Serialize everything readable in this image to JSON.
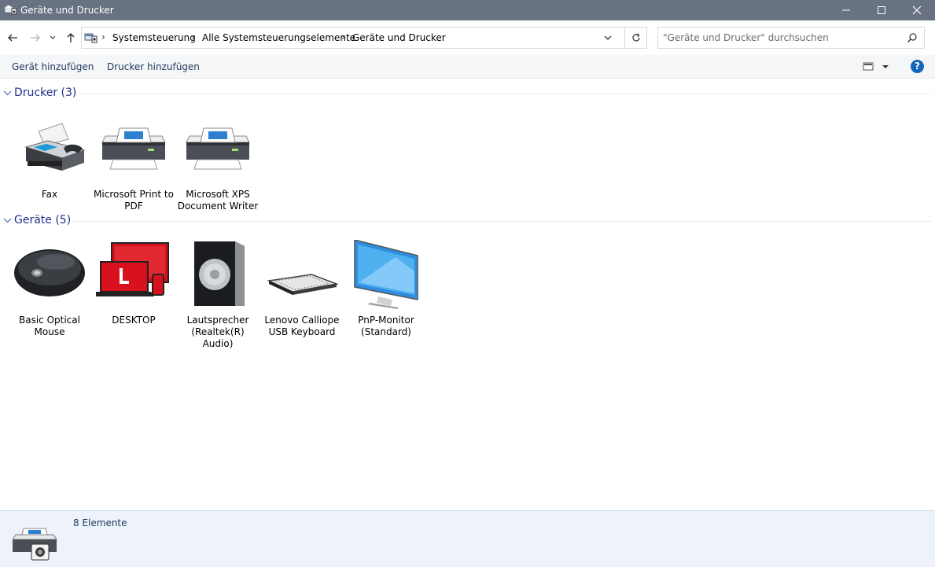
{
  "window": {
    "title": "Geräte und Drucker"
  },
  "address": {
    "breadcrumb": [
      "Systemsteuerung",
      "Alle Systemsteuerungselemente",
      "Geräte und Drucker"
    ]
  },
  "search": {
    "placeholder": "\"Geräte und Drucker\" durchsuchen"
  },
  "toolbar": {
    "add_device": "Gerät hinzufügen",
    "add_printer": "Drucker hinzufügen",
    "help": "?"
  },
  "groups": {
    "printers": {
      "label": "Drucker (3)",
      "items": [
        {
          "label": "Fax",
          "icon": "fax-icon"
        },
        {
          "label": "Microsoft Print to PDF",
          "icon": "printer-icon"
        },
        {
          "label": "Microsoft XPS Document Writer",
          "icon": "printer-icon"
        }
      ]
    },
    "devices": {
      "label": "Geräte (5)",
      "items": [
        {
          "label": "Basic Optical Mouse",
          "icon": "mouse-icon"
        },
        {
          "label": "DESKTOP",
          "icon": "computer-icon"
        },
        {
          "label": "Lautsprecher (Realtek(R) Audio)",
          "icon": "speaker-icon"
        },
        {
          "label": "Lenovo Calliope USB Keyboard",
          "icon": "keyboard-icon"
        },
        {
          "label": "PnP-Monitor (Standard)",
          "icon": "monitor-icon"
        }
      ]
    }
  },
  "status": {
    "count": "8 Elemente"
  },
  "colors": {
    "titlebar": "#697283",
    "group_header": "#1e3287",
    "toolbar_text": "#1e395b",
    "help": "#1467b8",
    "accent_red": "#d9101e"
  }
}
